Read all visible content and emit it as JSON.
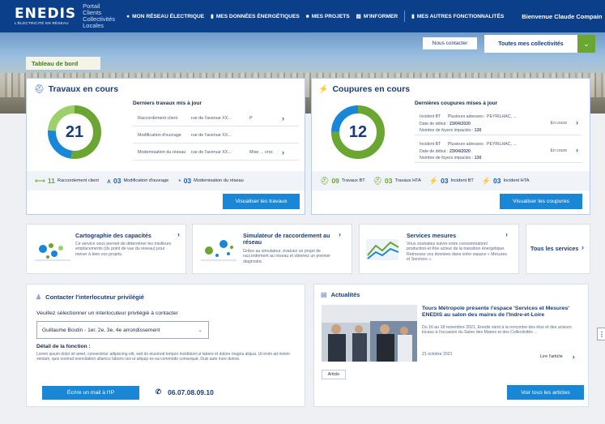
{
  "header": {
    "logo": "ENEDIS",
    "logo_tagline": "L'ÉLECTRICITÉ EN RÉSEAU",
    "portal_title": "Portail Clients Collectivités Locales",
    "nav": [
      {
        "label": "MON RÉSEAU ÉLECTRIQUE",
        "icon": "pin-icon"
      },
      {
        "label": "MES DONNÉES ÉNERGÉTIQUES",
        "icon": "bar-chart-icon"
      },
      {
        "label": "MES PROJETS",
        "icon": "folder-icon"
      },
      {
        "label": "M'INFORMER",
        "icon": "newspaper-icon"
      },
      {
        "label": "MES AUTRES FONCTIONNALITÉS",
        "icon": "book-icon"
      }
    ],
    "welcome": "Bienvenue Claude Compain"
  },
  "banner": {
    "contact_button": "Nous contacter",
    "collectivites_select": "Toutes mes collectivités",
    "dashboard_tab": "Tableau de bord"
  },
  "travaux": {
    "title": "Travaux en cours",
    "count": "21",
    "subtitle": "Derniers travaux mis à jour",
    "rows": [
      {
        "type": "Raccordement client",
        "address": "rue de l'avenue XX...",
        "extra": "P"
      },
      {
        "type": "Modification d'ouvrage",
        "address": "rue de l'avenue XX...",
        "extra": ""
      },
      {
        "type": "Modernisation du réseau",
        "address": "rue de l'avenue XX...",
        "extra": "Mise ... vrxx"
      }
    ],
    "stats": [
      {
        "n": "11",
        "label": "Raccordement client",
        "icon": "connection-icon"
      },
      {
        "n": "03",
        "label": "Modification d'ouvrage",
        "icon": "pylon-icon"
      },
      {
        "n": "03",
        "label": "Modernisation du réseau",
        "icon": "gauge-icon"
      }
    ],
    "button": "Visualiser les travaux",
    "donut_segments": [
      0.52,
      0.24,
      0.24
    ]
  },
  "coupures": {
    "title": "Coupures en cours",
    "count": "12",
    "subtitle": "Dernières coupures mises à jour",
    "rows": [
      {
        "type": "Incident BT",
        "address": "Plusieurs adresses : PEYRILHAC, ...",
        "date_label": "Date de début :",
        "date": "23/04/2020",
        "foyers_label": "Nombre de foyers impactés :",
        "foyers": "130",
        "status": "En cours"
      },
      {
        "type": "Incident BT",
        "address": "Plusieurs adresses : PEYRILHAC, ...",
        "date_label": "Date de début :",
        "date": "23/04/2020",
        "foyers_label": "Nombre de foyers impactés :",
        "foyers": "130",
        "status": "En cours"
      }
    ],
    "stats": [
      {
        "n": "09",
        "label": "Travaux BT",
        "icon": "worker-icon"
      },
      {
        "n": "03",
        "label": "Travaux HTA",
        "icon": "worker-icon"
      },
      {
        "n": "03",
        "label": "Incident BT",
        "icon": "lightning-icon"
      },
      {
        "n": "03",
        "label": "Incident HTA",
        "icon": "lightning-icon"
      }
    ],
    "button": "Visualiser les coupures",
    "donut_segments": [
      0.75,
      0.25
    ]
  },
  "cards": [
    {
      "title": "Cartographie des capacités",
      "desc": "Ce service vous permet de déterminer les meilleurs emplacements (du point de vue du réseau) pour mener à bien vos projets."
    },
    {
      "title": "Simulateur de raccordement au réseau",
      "desc": "Grâce au simulateur, évaluez un projet de raccordement au réseau et obtenez un premier diagnostic."
    },
    {
      "title": "Services mesures",
      "desc": "Vous souhaitez suivre votre consommation/ production et être acteur de la transition énergétique. Retrouvez vos données dans votre espace « Mesures et Services »."
    },
    {
      "title": "Tous les services",
      "desc": ""
    }
  ],
  "contact": {
    "title": "Contacter l'interlocuteur privilégié",
    "select_label": "Veuillez sélectionner un interlocuteur privilégié à contacter",
    "selected": "Guillaume Boutin - 1er, 2e, 3e, 4e arrondissement",
    "function_label": "Détail de la fonction :",
    "function_text": "Lorem ipsum dolor sit amet, consectetur adipiscing elit, sed do eiusmod tempor incididunt ut labore et dolore magna aliqua. Ut enim ad minim veniam, quis nostrud exercitation ullamco laboris nisi ut aliquip ex ea commodo consequat. Duis aute irure dolore.",
    "email_button": "Écrire un mail à l'IP",
    "phone": "06.07.08.09.10"
  },
  "news": {
    "title": "Actualités",
    "headline": "Tours Métropole présente l'espace 'Services et Mesures' ENEDIS au salon des maires de l'Indre-et-Loire",
    "summary": "Du 16 au 18 novembre 2021, Enedis vient à la rencontre des élus et des acteurs locaux à l'occasion du Salon des Maires et des Collectivités ...",
    "date": "21 octobre 2021",
    "read_more": "Lire l'article",
    "tag": "Article",
    "button": "Voir tous les articles"
  },
  "colors": {
    "navy": "#0c3f8a",
    "green": "#6aa631",
    "blue": "#1a86d6",
    "title": "#1b3c7a"
  }
}
